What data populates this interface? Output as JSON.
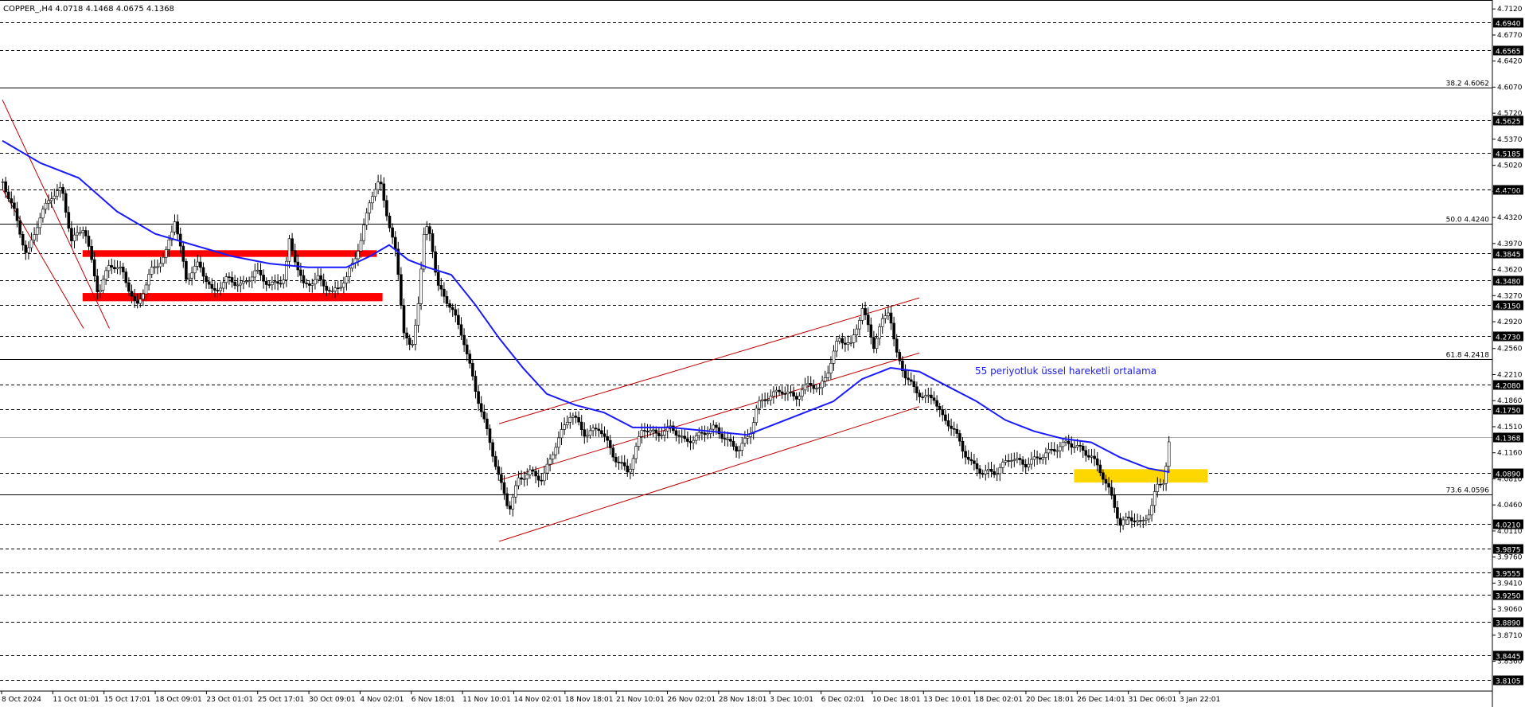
{
  "chart_data": {
    "type": "candlestick",
    "title": "COPPER_,H4  4.0718 4.1468 4.0675 4.1368",
    "symbol": "COPPER_,H4",
    "ohlc": {
      "open": 4.0718,
      "high": 4.1468,
      "low": 4.0675,
      "close": 4.1368
    },
    "y_range": [
      3.796,
      4.724
    ],
    "price_axis_ticks": [
      "4.7120",
      "4.6770",
      "4.6420",
      "4.6070",
      "4.5720",
      "4.5370",
      "4.5020",
      "4.4670",
      "4.4320",
      "4.3970",
      "4.3620",
      "4.3270",
      "4.2920",
      "4.2560",
      "4.2210",
      "4.1860",
      "4.1510",
      "4.1160",
      "4.0810",
      "4.0460",
      "4.0110",
      "3.9760",
      "3.9410",
      "3.9060",
      "3.8710",
      "3.8360"
    ],
    "time_axis_labels": [
      "8 Oct 2024",
      "11 Oct 01:01",
      "15 Oct 17:01",
      "18 Oct 09:01",
      "23 Oct 01:01",
      "25 Oct 17:01",
      "30 Oct 09:01",
      "4 Nov 02:01",
      "6 Nov 18:01",
      "11 Nov 10:01",
      "14 Nov 02:01",
      "18 Nov 18:01",
      "21 Nov 10:01",
      "26 Nov 02:01",
      "28 Nov 18:01",
      "3 Dec 10:01",
      "6 Dec 02:01",
      "10 Dec 18:01",
      "13 Dec 10:01",
      "18 Dec 02:01",
      "20 Dec 18:01",
      "26 Dec 14:01",
      "31 Dec 06:01",
      "3 Jan 22:01"
    ],
    "horizontal_levels": [
      "4.6940",
      "4.6565",
      "4.5625",
      "4.5185",
      "4.4700",
      "4.3845",
      "4.3480",
      "4.3150",
      "4.2730",
      "4.2080",
      "4.1750",
      "4.0890",
      "4.0210",
      "3.9875",
      "3.9555",
      "3.9250",
      "3.8890",
      "3.8445",
      "3.8105"
    ],
    "fibonacci_levels": [
      {
        "label": "38.2 4.6062",
        "value": 4.6062
      },
      {
        "label": "50.0 4.4240",
        "value": 4.424
      },
      {
        "label": "61.8 4.2418",
        "value": 4.2418
      },
      {
        "label": "73.6 4.0596",
        "value": 4.0596
      }
    ],
    "current_price": "4.1368",
    "ma_label": "55 periyotluk üssel hareketli ortalama",
    "ma_color": "#1a1aff",
    "channel_color": "#c00000",
    "zone_color_red": "#ff0000",
    "zone_color_yellow": "#ffd700",
    "grid": false,
    "legend": "none",
    "price_path": [
      [
        0,
        4.48
      ],
      [
        12,
        4.44
      ],
      [
        25,
        4.38
      ],
      [
        38,
        4.43
      ],
      [
        50,
        4.46
      ],
      [
        62,
        4.47
      ],
      [
        72,
        4.4
      ],
      [
        85,
        4.42
      ],
      [
        100,
        4.33
      ],
      [
        112,
        4.37
      ],
      [
        125,
        4.36
      ],
      [
        140,
        4.31
      ],
      [
        155,
        4.36
      ],
      [
        170,
        4.38
      ],
      [
        180,
        4.43
      ],
      [
        192,
        4.35
      ],
      [
        205,
        4.37
      ],
      [
        220,
        4.33
      ],
      [
        235,
        4.35
      ],
      [
        250,
        4.34
      ],
      [
        265,
        4.36
      ],
      [
        280,
        4.34
      ],
      [
        295,
        4.35
      ],
      [
        300,
        4.4
      ],
      [
        315,
        4.34
      ],
      [
        330,
        4.35
      ],
      [
        345,
        4.33
      ],
      [
        360,
        4.35
      ],
      [
        375,
        4.4
      ],
      [
        385,
        4.46
      ],
      [
        395,
        4.48
      ],
      [
        405,
        4.42
      ],
      [
        412,
        4.38
      ],
      [
        420,
        4.28
      ],
      [
        428,
        4.25
      ],
      [
        435,
        4.32
      ],
      [
        442,
        4.42
      ],
      [
        448,
        4.41
      ],
      [
        455,
        4.34
      ],
      [
        470,
        4.31
      ],
      [
        482,
        4.27
      ],
      [
        495,
        4.2
      ],
      [
        508,
        4.14
      ],
      [
        520,
        4.08
      ],
      [
        530,
        4.04
      ],
      [
        540,
        4.08
      ],
      [
        552,
        4.09
      ],
      [
        565,
        4.08
      ],
      [
        580,
        4.13
      ],
      [
        595,
        4.17
      ],
      [
        610,
        4.14
      ],
      [
        625,
        4.15
      ],
      [
        640,
        4.11
      ],
      [
        655,
        4.09
      ],
      [
        670,
        4.15
      ],
      [
        685,
        4.14
      ],
      [
        700,
        4.15
      ],
      [
        715,
        4.13
      ],
      [
        730,
        4.14
      ],
      [
        745,
        4.15
      ],
      [
        760,
        4.13
      ],
      [
        770,
        4.12
      ],
      [
        782,
        4.14
      ],
      [
        790,
        4.18
      ],
      [
        800,
        4.19
      ],
      [
        815,
        4.2
      ],
      [
        830,
        4.19
      ],
      [
        845,
        4.21
      ],
      [
        855,
        4.2
      ],
      [
        865,
        4.23
      ],
      [
        875,
        4.27
      ],
      [
        888,
        4.26
      ],
      [
        900,
        4.31
      ],
      [
        912,
        4.26
      ],
      [
        920,
        4.29
      ],
      [
        928,
        4.31
      ],
      [
        935,
        4.25
      ],
      [
        945,
        4.22
      ],
      [
        955,
        4.2
      ],
      [
        965,
        4.19
      ],
      [
        975,
        4.19
      ],
      [
        985,
        4.16
      ],
      [
        995,
        4.15
      ],
      [
        1005,
        4.12
      ],
      [
        1015,
        4.1
      ],
      [
        1025,
        4.09
      ],
      [
        1040,
        4.09
      ],
      [
        1055,
        4.11
      ],
      [
        1070,
        4.1
      ],
      [
        1085,
        4.11
      ],
      [
        1100,
        4.12
      ],
      [
        1115,
        4.13
      ],
      [
        1130,
        4.12
      ],
      [
        1140,
        4.11
      ],
      [
        1150,
        4.09
      ],
      [
        1160,
        4.06
      ],
      [
        1170,
        4.02
      ],
      [
        1180,
        4.03
      ],
      [
        1192,
        4.02
      ],
      [
        1202,
        4.04
      ],
      [
        1208,
        4.07
      ],
      [
        1216,
        4.08
      ],
      [
        1222,
        4.137
      ]
    ],
    "ema_path": [
      [
        0,
        4.535
      ],
      [
        40,
        4.505
      ],
      [
        80,
        4.485
      ],
      [
        120,
        4.44
      ],
      [
        160,
        4.41
      ],
      [
        200,
        4.395
      ],
      [
        240,
        4.38
      ],
      [
        280,
        4.37
      ],
      [
        320,
        4.365
      ],
      [
        360,
        4.365
      ],
      [
        385,
        4.38
      ],
      [
        405,
        4.395
      ],
      [
        425,
        4.375
      ],
      [
        445,
        4.365
      ],
      [
        470,
        4.355
      ],
      [
        495,
        4.315
      ],
      [
        520,
        4.27
      ],
      [
        545,
        4.23
      ],
      [
        570,
        4.195
      ],
      [
        600,
        4.18
      ],
      [
        630,
        4.17
      ],
      [
        660,
        4.15
      ],
      [
        700,
        4.15
      ],
      [
        740,
        4.145
      ],
      [
        780,
        4.14
      ],
      [
        810,
        4.155
      ],
      [
        840,
        4.17
      ],
      [
        870,
        4.185
      ],
      [
        900,
        4.215
      ],
      [
        930,
        4.23
      ],
      [
        960,
        4.225
      ],
      [
        990,
        4.205
      ],
      [
        1020,
        4.185
      ],
      [
        1050,
        4.16
      ],
      [
        1080,
        4.145
      ],
      [
        1110,
        4.135
      ],
      [
        1140,
        4.13
      ],
      [
        1170,
        4.11
      ],
      [
        1200,
        4.095
      ],
      [
        1222,
        4.09
      ]
    ],
    "channels": [
      {
        "name": "down-channel",
        "x1": 0,
        "y1": 4.59,
        "x2": 112,
        "y2": 4.283
      },
      {
        "name": "down-channel-lower",
        "x1": 0,
        "y1": 4.47,
        "x2": 85,
        "y2": 4.283
      },
      {
        "name": "up-channel-upper",
        "x1": 520,
        "y1": 4.155,
        "x2": 960,
        "y2": 4.324
      },
      {
        "name": "up-channel-mid",
        "x1": 520,
        "y1": 4.079,
        "x2": 960,
        "y2": 4.25
      },
      {
        "name": "up-channel-lower",
        "x1": 520,
        "y1": 3.997,
        "x2": 960,
        "y2": 4.178
      }
    ],
    "zones": [
      {
        "name": "red-zone-upper",
        "x1": 84,
        "x2": 392,
        "y_top": 4.388,
        "y_bot": 4.379,
        "color": "#ff0000"
      },
      {
        "name": "red-zone-lower",
        "x1": 84,
        "x2": 398,
        "y_top": 4.3305,
        "y_bot": 4.3195,
        "color": "#ff0000"
      },
      {
        "name": "yellow-zone",
        "x1": 1122,
        "x2": 1262,
        "y_top": 4.094,
        "y_bot": 4.076,
        "color": "#ffd700"
      }
    ]
  }
}
